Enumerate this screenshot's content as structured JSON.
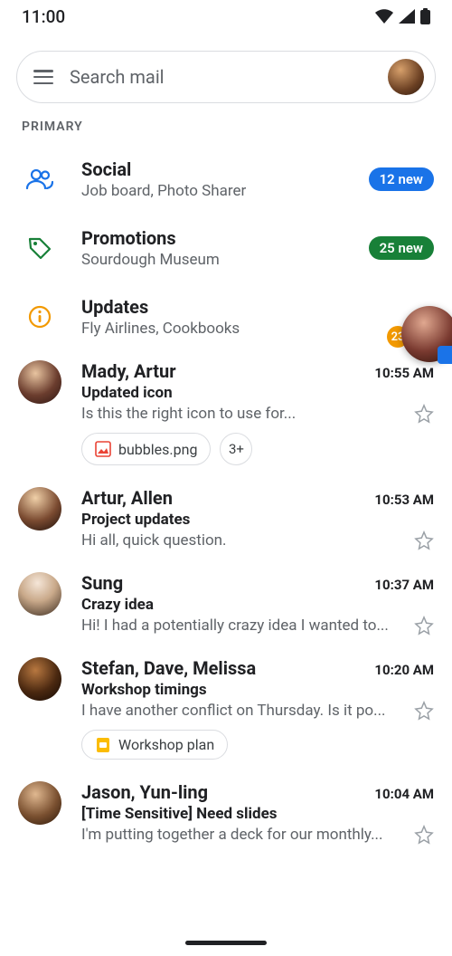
{
  "status": {
    "time": "11:00"
  },
  "search": {
    "placeholder": "Search mail"
  },
  "section_label": "PRIMARY",
  "tabs": [
    {
      "title": "Social",
      "subtitle": "Job board, Photo Sharer",
      "badge": "12 new",
      "badge_color": "blue",
      "icon": "people-icon"
    },
    {
      "title": "Promotions",
      "subtitle": "Sourdough Museum",
      "badge": "25 new",
      "badge_color": "green",
      "icon": "tag-icon"
    },
    {
      "title": "Updates",
      "subtitle": "Fly Airlines, Cookbooks",
      "badge": "23",
      "badge_color": "orange-partial",
      "icon": "info-icon"
    }
  ],
  "emails": [
    {
      "sender": "Mady, Artur",
      "time": "10:55 AM",
      "subject": "Updated icon",
      "snippet": "Is this the right icon to use for...",
      "attachments": [
        {
          "kind": "image",
          "label": "bubbles.png"
        }
      ],
      "attachment_overflow": "3+",
      "avatar": "av1"
    },
    {
      "sender": "Artur, Allen",
      "time": "10:53 AM",
      "subject": "Project updates",
      "snippet": "Hi all, quick question.",
      "avatar": "av2"
    },
    {
      "sender": "Sung",
      "time": "10:37 AM",
      "subject": "Crazy idea",
      "snippet": "Hi! I had a potentially crazy idea I wanted to...",
      "avatar": "av3"
    },
    {
      "sender": "Stefan, Dave, Melissa",
      "time": "10:20 AM",
      "subject": "Workshop timings",
      "snippet": "I have another conflict on Thursday. Is it po...",
      "attachments": [
        {
          "kind": "slides",
          "label": "Workshop plan"
        }
      ],
      "avatar": "av4"
    },
    {
      "sender": "Jason, Yun-ling",
      "time": "10:04 AM",
      "subject": "[Time Sensitive] Need slides",
      "snippet": "I'm putting together a deck for our monthly...",
      "avatar": "av5"
    }
  ]
}
